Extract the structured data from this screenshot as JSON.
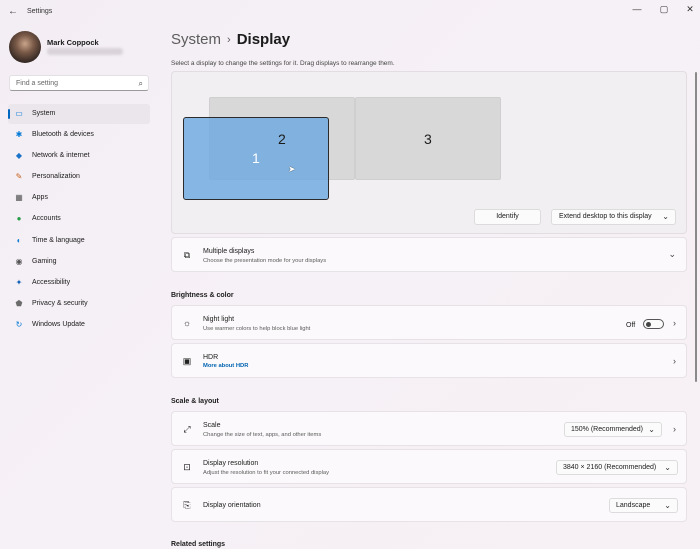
{
  "window": {
    "title": "Settings",
    "back": "←",
    "minimize": "—",
    "maximize": "▢",
    "close": "✕"
  },
  "user": {
    "name": "Mark Coppock"
  },
  "search": {
    "placeholder": "Find a setting",
    "icon": "⌕"
  },
  "sidebar": {
    "items": [
      {
        "label": "System",
        "icon": "▭",
        "color": "#0078d4",
        "active": true
      },
      {
        "label": "Bluetooth & devices",
        "icon": "✱",
        "color": "#0078d4"
      },
      {
        "label": "Network & internet",
        "icon": "◆",
        "color": "#1a73c8"
      },
      {
        "label": "Personalization",
        "icon": "✎",
        "color": "#c7601a"
      },
      {
        "label": "Apps",
        "icon": "▦",
        "color": "#555555"
      },
      {
        "label": "Accounts",
        "icon": "●",
        "color": "#2a9d4b"
      },
      {
        "label": "Time & language",
        "icon": "◐",
        "color": "#0f7bd1"
      },
      {
        "label": "Gaming",
        "icon": "◉",
        "color": "#555555"
      },
      {
        "label": "Accessibility",
        "icon": "✦",
        "color": "#1561b5"
      },
      {
        "label": "Privacy & security",
        "icon": "⬟",
        "color": "#6b6b6b"
      },
      {
        "label": "Windows Update",
        "icon": "↻",
        "color": "#0078d4"
      }
    ]
  },
  "breadcrumb": {
    "parent": "System",
    "separator": "›",
    "current": "Display"
  },
  "instruction": "Select a display to change the settings for it. Drag displays to rearrange them.",
  "monitors": {
    "one": "1",
    "two": "2",
    "three": "3"
  },
  "display_actions": {
    "identify": "Identify",
    "extend": "Extend desktop to this display",
    "cursor": "➤"
  },
  "multiple_displays": {
    "title": "Multiple displays",
    "subtitle": "Choose the presentation mode for your displays",
    "icon": "⧉",
    "chevron": "⌄"
  },
  "brightness_section": "Brightness & color",
  "night_light": {
    "title": "Night light",
    "subtitle": "Use warmer colors to help block blue light",
    "state": "Off",
    "icon": "☼",
    "chevron": "›"
  },
  "hdr": {
    "title": "HDR",
    "link": "More about HDR",
    "icon": "▣",
    "chevron": "›"
  },
  "scale_section": "Scale & layout",
  "scale": {
    "title": "Scale",
    "subtitle": "Change the size of text, apps, and other items",
    "value": "150% (Recommended)",
    "icon": "⤢",
    "chevron": "›"
  },
  "resolution": {
    "title": "Display resolution",
    "subtitle": "Adjust the resolution to fit your connected display",
    "value": "3840 × 2160 (Recommended)",
    "icon": "⊡"
  },
  "orientation": {
    "title": "Display orientation",
    "value": "Landscape",
    "icon": "⎘"
  },
  "related_section": "Related settings",
  "dropdown_chevron": "⌄",
  "accent_color": "#0067c0"
}
